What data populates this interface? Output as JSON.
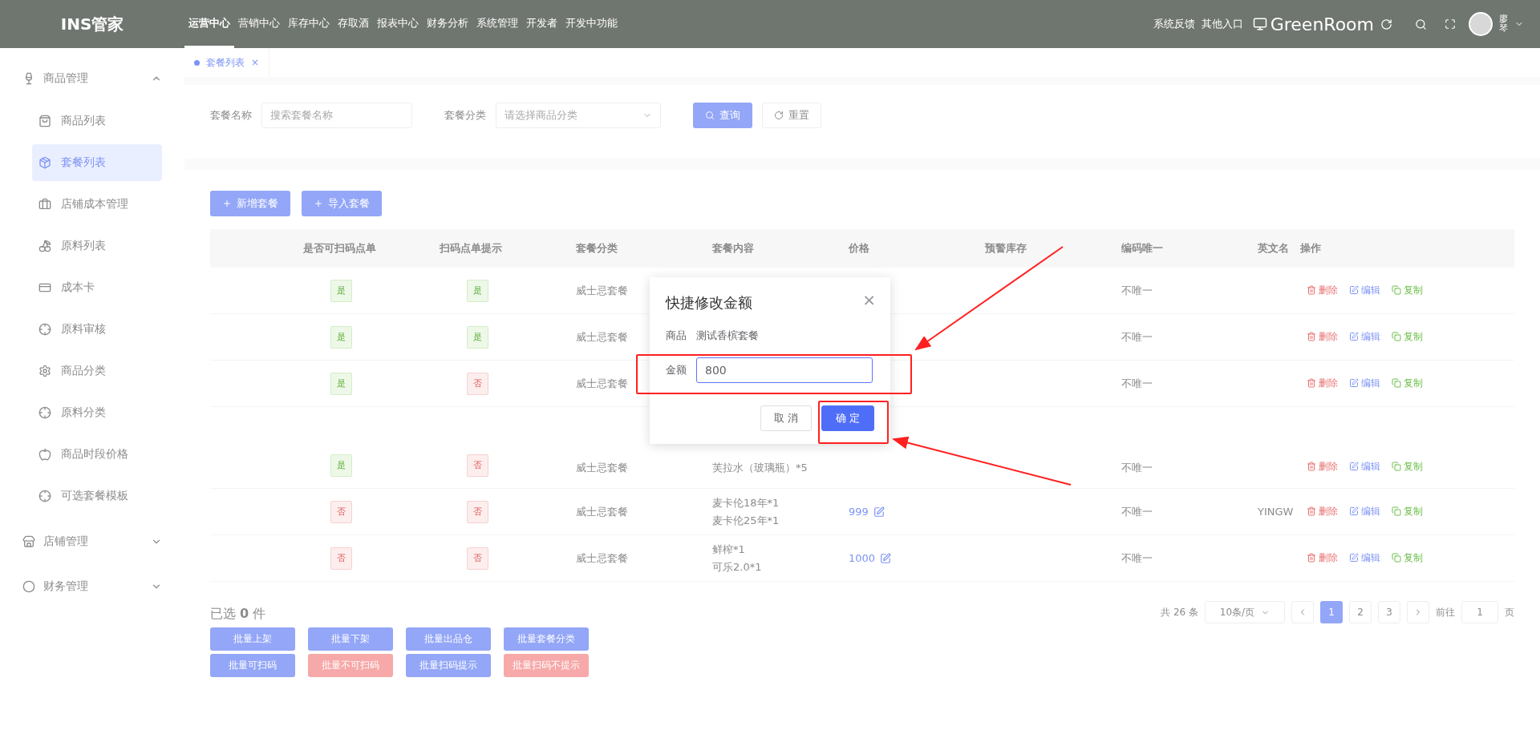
{
  "topbar": {
    "logo": "INS管家",
    "menu": [
      {
        "label": "运营中心",
        "selected": true
      },
      {
        "label": "营销中心",
        "selected": false
      },
      {
        "label": "库存中心",
        "selected": false
      },
      {
        "label": "存取酒",
        "selected": false
      },
      {
        "label": "报表中心",
        "selected": false
      },
      {
        "label": "财务分析",
        "selected": false
      },
      {
        "label": "系统管理",
        "selected": false
      },
      {
        "label": "开发者",
        "selected": false
      },
      {
        "label": "开发中功能",
        "selected": false
      }
    ],
    "links": [
      "系统反馈",
      "其他入口"
    ],
    "store": "GreenRoom",
    "user": "廖琴"
  },
  "sidebar": {
    "groups": [
      {
        "label": "商品管理",
        "expanded": true,
        "children": [
          {
            "label": "商品列表",
            "selected": false
          },
          {
            "label": "套餐列表",
            "selected": true
          },
          {
            "label": "店铺成本管理",
            "selected": false
          },
          {
            "label": "原料列表",
            "selected": false
          },
          {
            "label": "成本卡",
            "selected": false
          },
          {
            "label": "原料审核",
            "selected": false
          },
          {
            "label": "商品分类",
            "selected": false
          },
          {
            "label": "原料分类",
            "selected": false
          },
          {
            "label": "商品时段价格",
            "selected": false
          },
          {
            "label": "可选套餐模板",
            "selected": false
          }
        ]
      },
      {
        "label": "店铺管理",
        "expanded": false
      },
      {
        "label": "财务管理",
        "expanded": false
      }
    ]
  },
  "page_tab": {
    "label": "套餐列表",
    "close": "×"
  },
  "filters": [
    {
      "label": "套餐名称",
      "placeholder": "搜索套餐名称",
      "kind": "text"
    },
    {
      "label": "套餐分类",
      "placeholder": "请选择商品分类",
      "kind": "select"
    }
  ],
  "filter_buttons": [
    {
      "label": "查询",
      "kind": "primary"
    },
    {
      "label": "重置",
      "kind": "plain"
    }
  ],
  "actions": [
    "新增套餐",
    "导入套餐"
  ],
  "table": {
    "columns": [
      "",
      "是否可扫码点单",
      "扫码点单提示",
      "套餐分类",
      "套餐内容",
      "价格",
      "预警库存",
      "编码唯一",
      "英文名",
      "操作"
    ],
    "rows": [
      {
        "scan": {
          "text": "是",
          "kind": "yes"
        },
        "hint": {
          "text": "是",
          "kind": "yes"
        },
        "category": "威士忌套餐",
        "content": [],
        "price": "",
        "english": "",
        "unique": "不唯一",
        "ops": [
          "删除",
          "编辑",
          "复制"
        ],
        "tall": false
      },
      {
        "scan": {
          "text": "是",
          "kind": "yes"
        },
        "hint": {
          "text": "是",
          "kind": "yes"
        },
        "category": "威士忌套餐",
        "content": [],
        "price": "",
        "english": "",
        "unique": "不唯一",
        "ops": [
          "删除",
          "编辑",
          "复制"
        ],
        "tall": false
      },
      {
        "scan": {
          "text": "是",
          "kind": "yes"
        },
        "hint": {
          "text": "否",
          "kind": "no"
        },
        "category": "威士忌套餐",
        "content": [],
        "price": "",
        "english": "",
        "unique": "不唯一",
        "ops": [
          "删除",
          "编辑",
          "复制"
        ],
        "tall": false
      },
      {
        "scan": {
          "text": "是",
          "kind": "yes"
        },
        "hint": {
          "text": "否",
          "kind": "no"
        },
        "category": "威士忌套餐",
        "content": [
          "芙拉水（玻璃瓶）*5"
        ],
        "price": "",
        "english": "",
        "unique": "不唯一",
        "ops": [
          "删除",
          "编辑",
          "复制"
        ],
        "tall": true
      },
      {
        "scan": {
          "text": "否",
          "kind": "no"
        },
        "hint": {
          "text": "否",
          "kind": "no"
        },
        "category": "威士忌套餐",
        "content": [
          "麦卡伦18年*1",
          "麦卡伦25年*1"
        ],
        "price": "999",
        "english": "YINGW",
        "unique": "不唯一",
        "ops": [
          "删除",
          "编辑",
          "复制"
        ],
        "tall": false
      },
      {
        "scan": {
          "text": "否",
          "kind": "no"
        },
        "hint": {
          "text": "否",
          "kind": "no"
        },
        "category": "威士忌套餐",
        "content": [
          "鲜榨*1",
          "可乐2.0*1"
        ],
        "price": "1000",
        "english": "",
        "unique": "不唯一",
        "ops": [
          "删除",
          "编辑",
          "复制"
        ],
        "tall": false
      }
    ]
  },
  "selection": {
    "prefix": "已选",
    "count": "0",
    "suffix": "件"
  },
  "batch_buttons": [
    {
      "label": "批量上架",
      "kind": "primary"
    },
    {
      "label": "批量下架",
      "kind": "primary"
    },
    {
      "label": "批量出品仓",
      "kind": "primary"
    },
    {
      "label": "批量套餐分类",
      "kind": "primary"
    },
    {
      "label": "批量可扫码",
      "kind": "primary"
    },
    {
      "label": "批量不可扫码",
      "kind": "danger"
    },
    {
      "label": "批量扫码提示",
      "kind": "primary"
    },
    {
      "label": "批量扫码不提示",
      "kind": "danger"
    }
  ],
  "pagination": {
    "total": "共 26 条",
    "page_size": "10条/页",
    "pages": [
      {
        "label": "1",
        "selected": true
      },
      {
        "label": "2",
        "selected": false
      },
      {
        "label": "3",
        "selected": false
      }
    ],
    "goto_label": "前往",
    "goto_value": "1",
    "goto_suffix": "页"
  },
  "dialog": {
    "title": "快捷修改金额",
    "close": "×",
    "product_label": "商品",
    "product_value": "测试香槟套餐",
    "amount_label": "金额",
    "amount_value": "800",
    "cancel": "取 消",
    "confirm": "确 定"
  }
}
